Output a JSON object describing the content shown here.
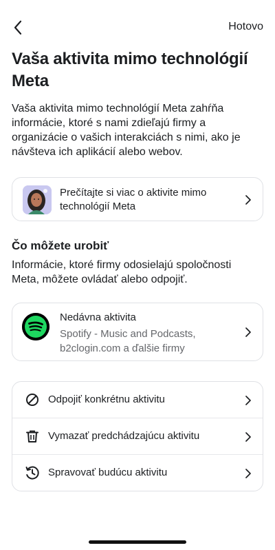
{
  "header": {
    "done_label": "Hotovo"
  },
  "page": {
    "title": "Vaša aktivita mimo technológií Meta",
    "intro": "Vaša aktivita mimo technológií Meta zahŕňa informácie, ktoré s nami zdieľajú firmy a organizácie o vašich interakciách s nimi, ako je návšteva ich aplikácií alebo webov."
  },
  "learn_more": {
    "label": "Prečítajte si viac o aktivite mimo technológií Meta"
  },
  "what_you_can_do": {
    "title": "Čo môžete urobiť",
    "description": "Informácie, ktoré firmy odosielajú spoločnosti Meta, môžete ovládať alebo odpojiť."
  },
  "recent_activity": {
    "title": "Nedávna aktivita",
    "subtitle": "Spotify - Music and Podcasts, b2clogin.com a ďalšie firmy",
    "icon": "spotify-icon",
    "brand_color": "#1ed760"
  },
  "actions": [
    {
      "label": "Odpojiť konkrétnu aktivitu",
      "icon": "disconnect-icon"
    },
    {
      "label": "Vymazať predchádzajúcu aktivitu",
      "icon": "trash-icon"
    },
    {
      "label": "Spravovať budúcu aktivitu",
      "icon": "future-activity-icon"
    }
  ]
}
